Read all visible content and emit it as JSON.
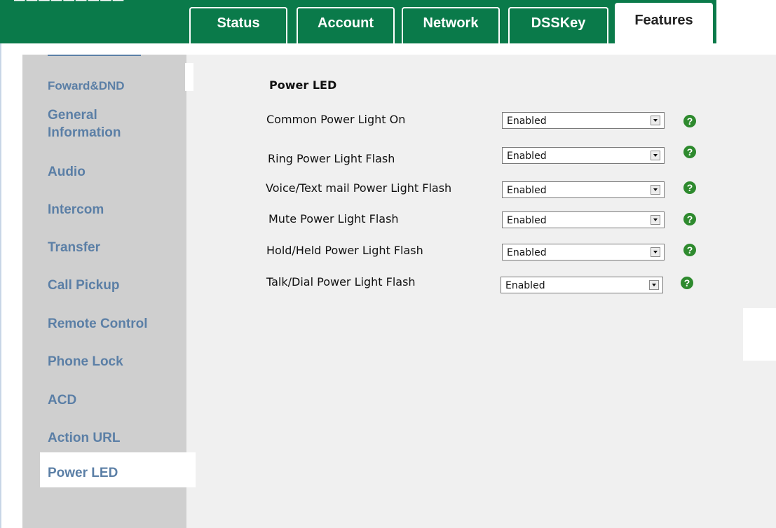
{
  "header": {
    "tabs": [
      {
        "label": "Status"
      },
      {
        "label": "Account"
      },
      {
        "label": "Network"
      },
      {
        "label": "DSSKey"
      },
      {
        "label": "Features",
        "active": true
      }
    ]
  },
  "sidebar": {
    "items": [
      {
        "label": "Foward&DND"
      },
      {
        "label": "General"
      },
      {
        "label": "Information"
      },
      {
        "label": "Audio"
      },
      {
        "label": "Intercom"
      },
      {
        "label": "Transfer"
      },
      {
        "label": "Call Pickup"
      },
      {
        "label": "Remote Control"
      },
      {
        "label": "Phone Lock"
      },
      {
        "label": "ACD"
      },
      {
        "label": "Action URL"
      },
      {
        "label": "Power LED",
        "active": true
      }
    ]
  },
  "main": {
    "section_title": "Power LED",
    "rows": [
      {
        "label": "Common Power Light On",
        "value": "Enabled"
      },
      {
        "label": "Ring Power Light Flash",
        "value": "Enabled"
      },
      {
        "label": "Voice/Text mail Power Light Flash",
        "value": "Enabled"
      },
      {
        "label": "Mute Power Light Flash",
        "value": "Enabled"
      },
      {
        "label": "Hold/Held Power Light Flash",
        "value": "Enabled"
      },
      {
        "label": "Talk/Dial Power Light Flash",
        "value": "Enabled"
      }
    ],
    "help_glyph": "?"
  },
  "colors": {
    "header_green": "#0a7a4a",
    "sidebar_gray": "#cfcfcf",
    "sidebar_link": "#5b7fa6",
    "help_green": "#2e8a2e"
  }
}
